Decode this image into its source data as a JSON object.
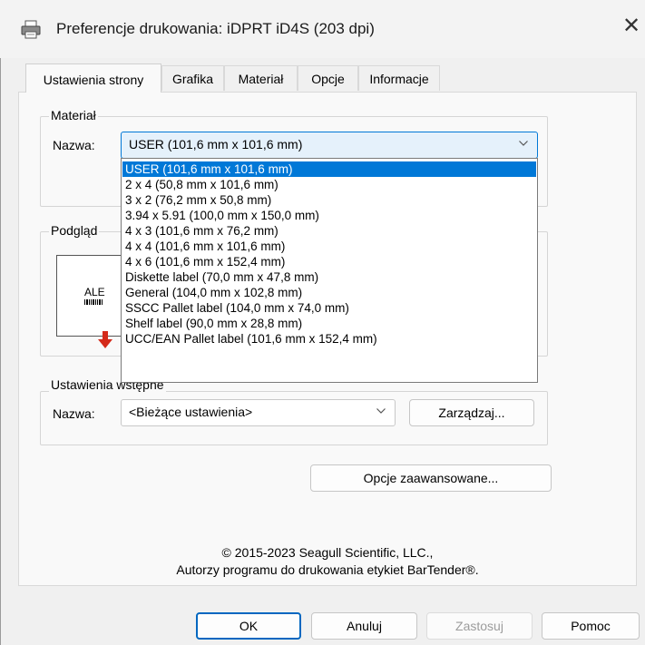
{
  "window": {
    "title": "Preferencje drukowania: iDPRT iD4S (203 dpi)",
    "close_glyph": "✕",
    "printer_icon": "printer-icon"
  },
  "tabs": [
    {
      "label": "Ustawienia strony",
      "active": true
    },
    {
      "label": "Grafika",
      "active": false
    },
    {
      "label": "Materiał",
      "active": false
    },
    {
      "label": "Opcje",
      "active": false
    },
    {
      "label": "Informacje",
      "active": false
    }
  ],
  "material": {
    "legend": "Materiał",
    "name_label": "Nazwa:",
    "selected": "USER (101,6 mm x 101,6 mm)",
    "options": [
      "USER (101,6 mm x 101,6 mm)",
      "2 x 4 (50,8 mm x 101,6 mm)",
      "3 x 2 (76,2 mm x 50,8 mm)",
      "3.94 x 5.91 (100,0 mm x 150,0 mm)",
      "4 x 3 (101,6 mm x 76,2 mm)",
      "4 x 4 (101,6 mm x 101,6 mm)",
      "4 x 6 (101,6 mm x 152,4 mm)",
      "Diskette label (70,0 mm x 47,8 mm)",
      "General (104,0 mm x 102,8 mm)",
      "SSCC Pallet label (104,0 mm x 74,0 mm)",
      "Shelf label (90,0 mm x 28,8 mm)",
      "UCC/EAN Pallet label (101,6 mm x 152,4 mm)"
    ]
  },
  "preview": {
    "legend": "Podgląd",
    "label_text": "ALE"
  },
  "presets": {
    "legend": "Ustawienia wstępne",
    "name_label": "Nazwa:",
    "selected": "<Bieżące ustawienia>",
    "manage_button": "Zarządzaj..."
  },
  "advanced_button": "Opcje zaawansowane...",
  "copyright": {
    "line1": "© 2015-2023 Seagull Scientific, LLC.,",
    "line2": "Autorzy programu do drukowania etykiet BarTender®."
  },
  "buttons": {
    "ok": "OK",
    "cancel": "Anuluj",
    "apply": "Zastosuj",
    "help": "Pomoc"
  },
  "colors": {
    "accent": "#0078d7",
    "arrow": "#d42a1a"
  }
}
